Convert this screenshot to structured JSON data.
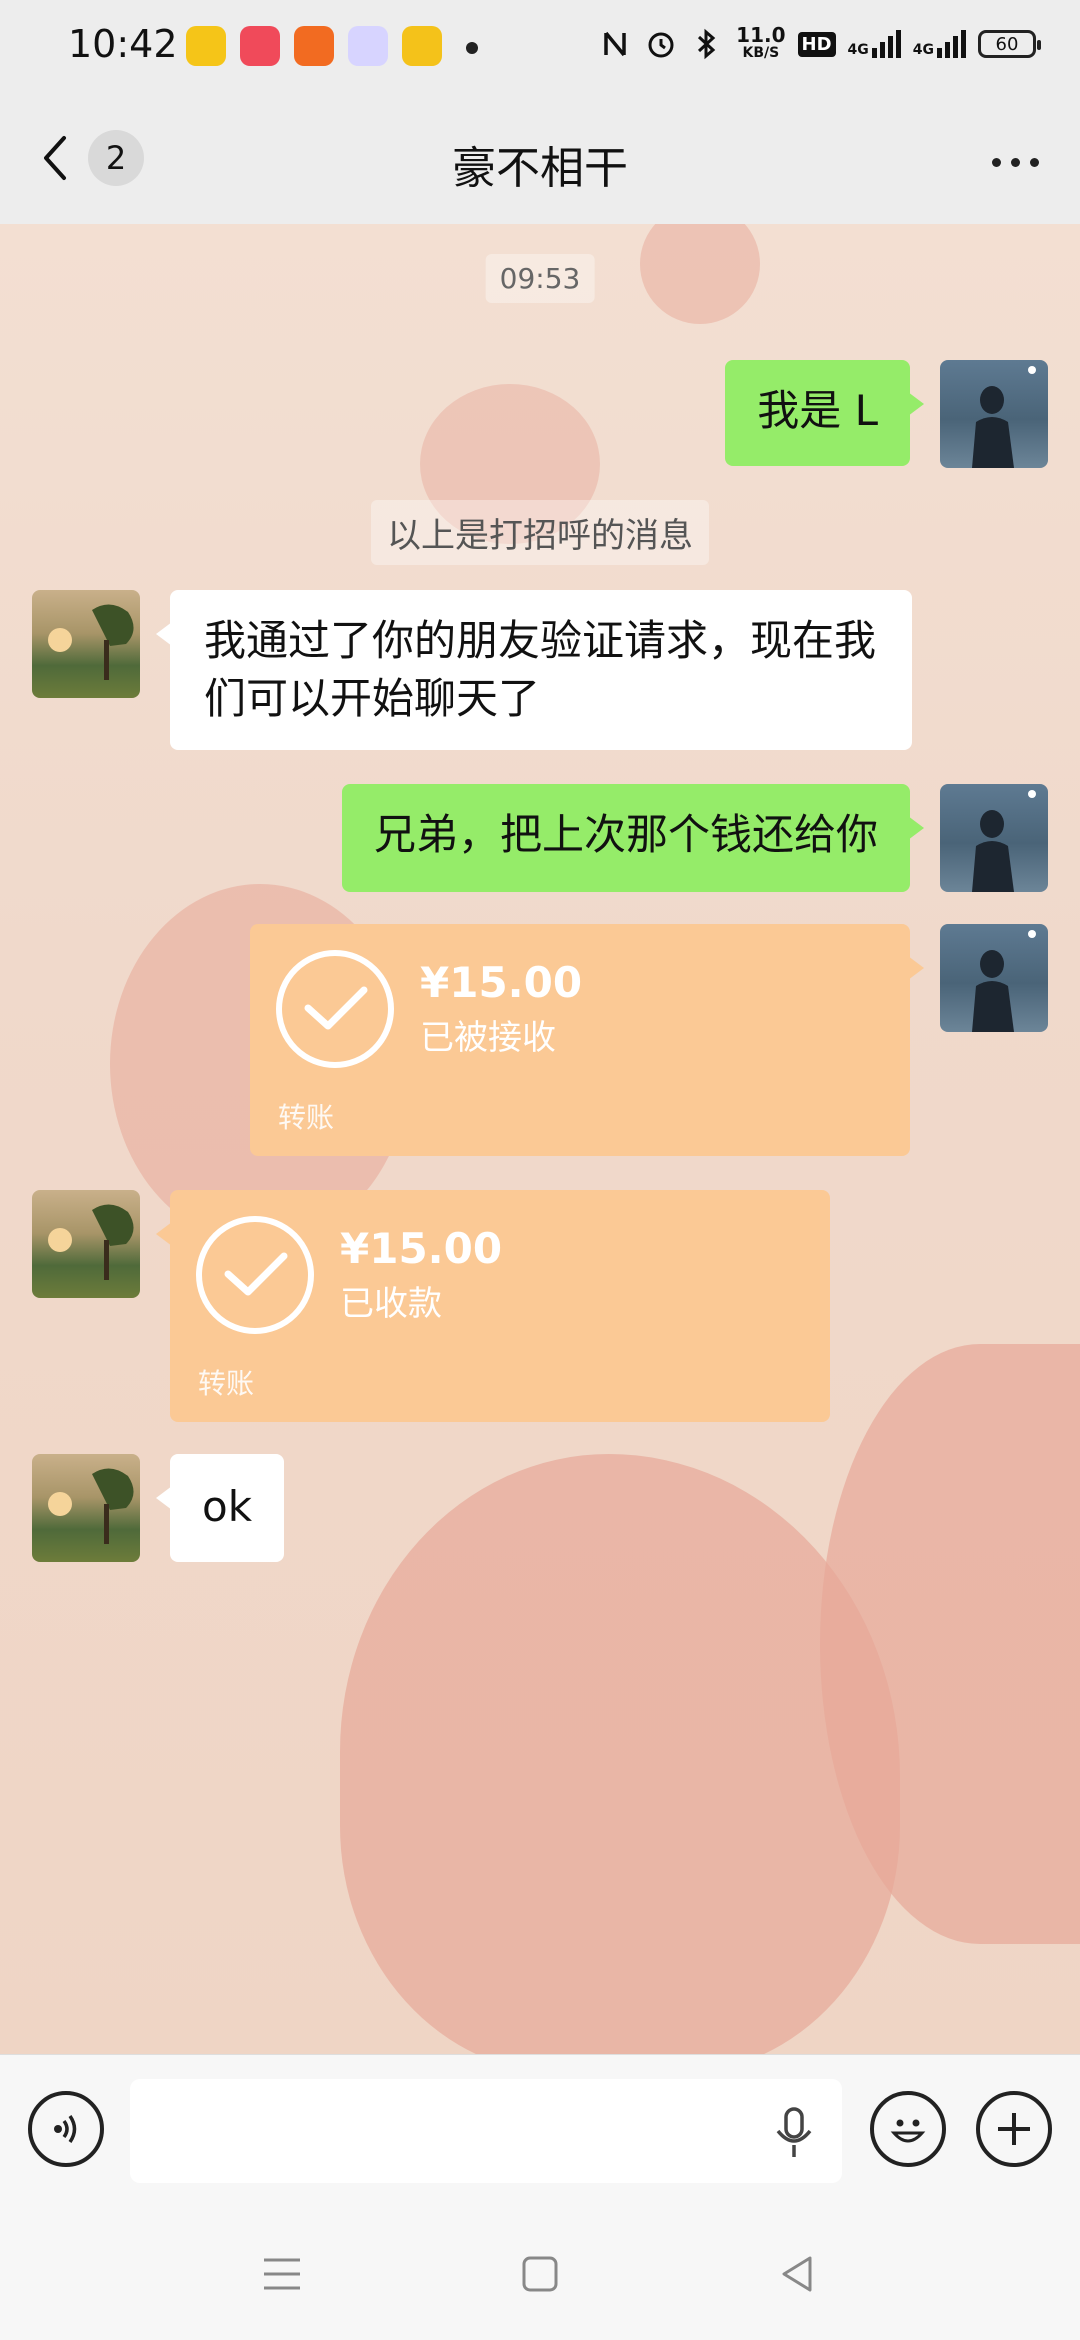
{
  "status_bar": {
    "time": "10:42",
    "net_speed_value": "11.0",
    "net_speed_unit": "KB/S",
    "hd_label": "HD",
    "signal_1": "4G",
    "signal_2": "4G",
    "battery": "60"
  },
  "header": {
    "back_icon": "chevron-left-icon",
    "unread_count": "2",
    "title": "豪不相干",
    "more_icon": "more-dots-icon"
  },
  "chat": {
    "time_stamp": "09:53",
    "system_notice": "以上是打招呼的消息",
    "messages": [
      {
        "side": "right",
        "type": "text",
        "text": "我是 L"
      },
      {
        "side": "left",
        "type": "text",
        "text": "我通过了你的朋友验证请求，现在我们可以开始聊天了"
      },
      {
        "side": "right",
        "type": "text",
        "text": "兄弟，把上次那个钱还给你"
      },
      {
        "side": "right",
        "type": "transfer",
        "amount": "¥15.00",
        "status": "已被接收",
        "label": "转账"
      },
      {
        "side": "left",
        "type": "transfer",
        "amount": "¥15.00",
        "status": "已收款",
        "label": "转账"
      },
      {
        "side": "left",
        "type": "text",
        "text": "ok"
      }
    ]
  },
  "input_bar": {
    "voice_icon": "voice-mode-icon",
    "input_value": "",
    "mic_icon": "microphone-icon",
    "emoji_icon": "emoji-icon",
    "add_icon": "plus-icon"
  },
  "colors": {
    "bubble_mine": "#95ec69",
    "bubble_theirs": "#ffffff",
    "transfer": "#fbc995",
    "background": "#f0d9cb"
  }
}
